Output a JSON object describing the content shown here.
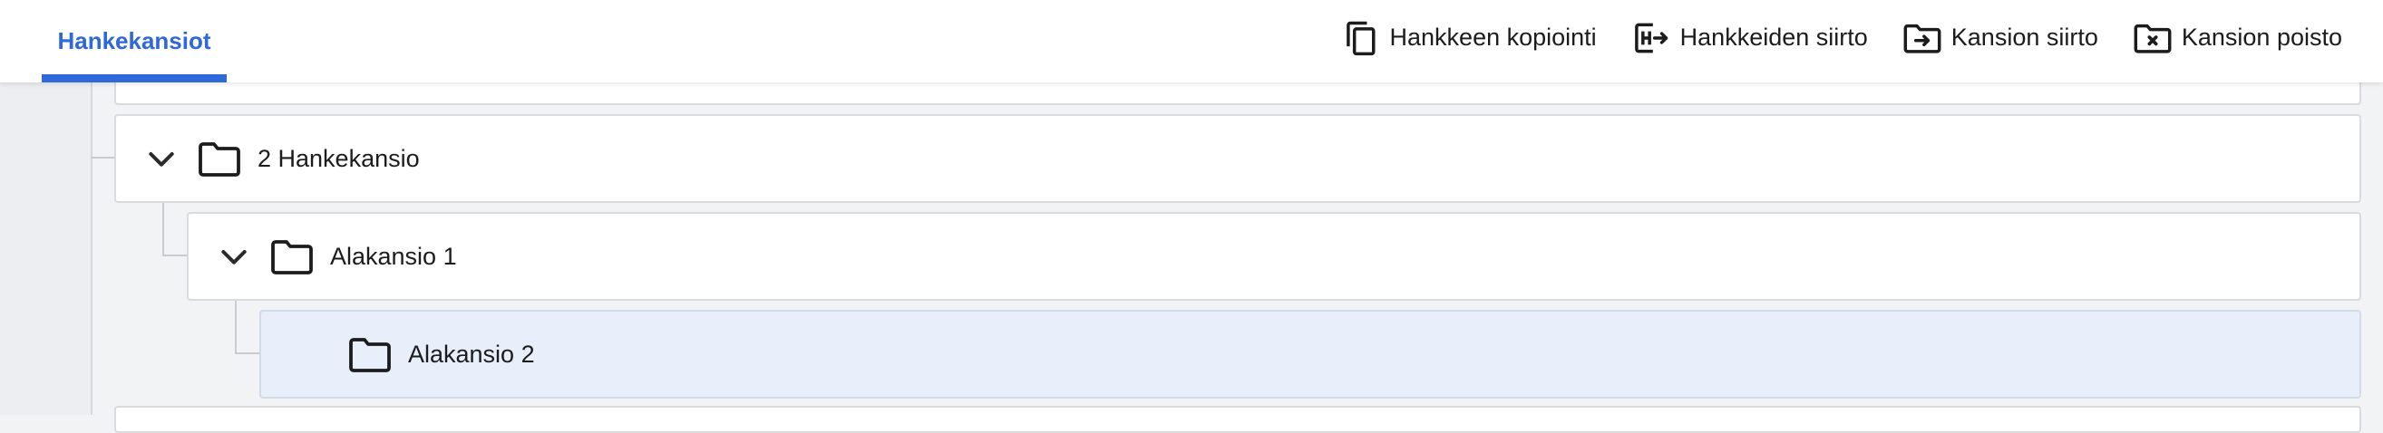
{
  "tabs": [
    {
      "label": "Hankekansiot",
      "active": true
    }
  ],
  "toolbar": {
    "copy_project": "Hankkeen kopiointi",
    "move_projects": "Hankkeiden siirto",
    "move_folder": "Kansion siirto",
    "delete_folder": "Kansion poisto"
  },
  "tree": {
    "folder_2": {
      "label": "2 Hankekansio",
      "expanded": true
    },
    "subfolder_1": {
      "label": "Alakansio 1",
      "expanded": true
    },
    "subfolder_2": {
      "label": "Alakansio 2",
      "selected": true
    }
  },
  "colors": {
    "accent": "#2f68d8",
    "selected_row": "#e8eefa",
    "background": "#f2f3f5"
  }
}
